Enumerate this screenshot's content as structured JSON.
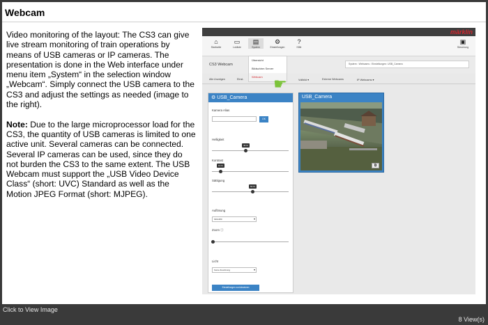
{
  "title": "Webcam",
  "body": {
    "p1": "Video monitoring of the layout: The CS3 can give live stream monitoring of train operations by means of USB cameras or IP cameras. The presentation is done in the Web interface under menu item „System“ in the selection window „Webcam“. Simply connect the USB camera to the CS3 and adjust the settings as needed (image to the right).",
    "note_label": "Note:",
    "p2": " Due to the large microprocessor load for the CS3, the quantity of USB cameras is limited to one active unit. Several cameras can be connected. Several IP cameras can be used, since they do not burden the CS3 to the same extent. The USB Webcam must support the „USB Video Device Class“ (short: UVC) Standard as well as the Motion JPEG Format (short: MJPEG)."
  },
  "screenshot": {
    "logo": "märklin",
    "toolbar": [
      {
        "icon": "home-icon",
        "glyph": "⌂",
        "label": "Startseite"
      },
      {
        "icon": "loco-list-icon",
        "glyph": "▭",
        "label": "Lokliste"
      },
      {
        "icon": "system-icon",
        "glyph": "▤",
        "label": "System"
      },
      {
        "icon": "gear-icon",
        "glyph": "⚙",
        "label": "Einstellungen"
      },
      {
        "icon": "help-icon",
        "glyph": "?",
        "label": "Hilfe"
      },
      {
        "icon": "control-icon",
        "glyph": "▣",
        "label": "Steuerung"
      }
    ],
    "dropdown": [
      "Übersicht",
      "Bildschirm Server",
      "Webcam"
    ],
    "page_title": "CS3 Webcam",
    "breadcrumb": "System : Webcams : Einstellungen: USB_Camera",
    "tabs": [
      "Alle Anzeigen",
      "Einst.",
      "Vollbild ▾",
      "Externe Webcams",
      "IP Webcams ▾"
    ],
    "panel_title": "⚙ USB_Camera",
    "alias_label": "Kamera Alias",
    "ok_label": "OK",
    "brightness_label": "Helligkeit",
    "brightness_value": "45 %",
    "contrast_label": "Kontrast",
    "contrast_value": "10 %",
    "saturation_label": "Sättigung",
    "saturation_value": "50 %",
    "resolution_label": "Auflösung",
    "resolution_value": "640x480",
    "zoom_label": "Zoom ⓘ",
    "light_label": "Licht",
    "light_value": "Keine Zuordnung",
    "reset_label": "Einstellungen zurücksetzen",
    "camera_title": "USB_Camera",
    "expand_icon": "⧉"
  },
  "footer": {
    "click_label": "Click to View Image",
    "views": "8 View(s)"
  }
}
